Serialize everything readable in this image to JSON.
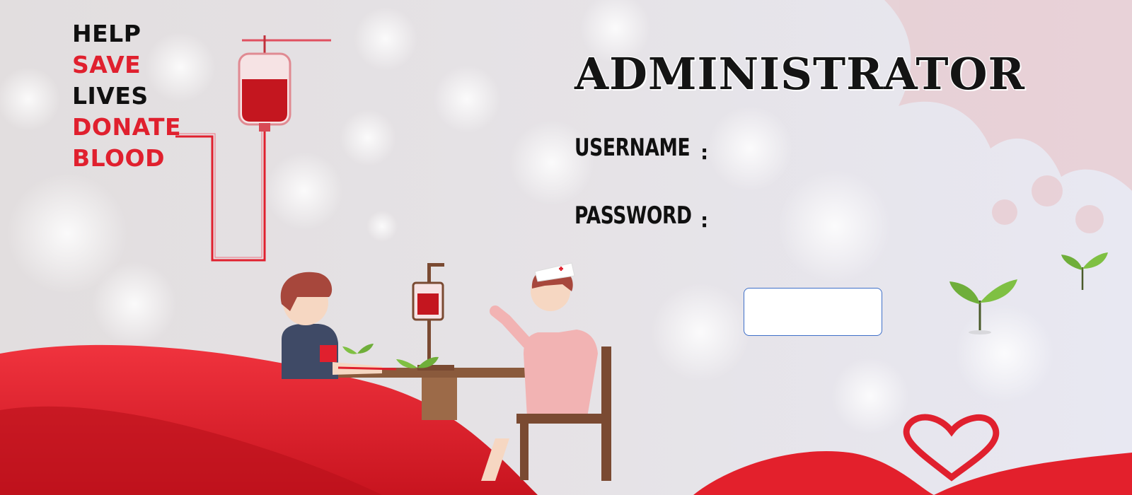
{
  "slogan": {
    "lines": [
      {
        "text": "HELP",
        "color": "#101010"
      },
      {
        "text": "SAVE",
        "color": "#e0202e"
      },
      {
        "text": "LIVES",
        "color": "#101010"
      },
      {
        "text": "DONATE",
        "color": "#e0202e"
      },
      {
        "text": "BLOOD",
        "color": "#e0202e"
      }
    ]
  },
  "form": {
    "title": "ADMINISTRATOR",
    "username_label": "USERNAME",
    "password_label": "PASSWORD",
    "separator": ":",
    "username_value": "",
    "password_value": "",
    "submit_label": ""
  },
  "colors": {
    "accent_red": "#e0202e",
    "button_border": "#3e6fc8"
  },
  "icons": [
    "blood-bag-icon",
    "heart-ribbon-icon",
    "sprout-icon"
  ]
}
